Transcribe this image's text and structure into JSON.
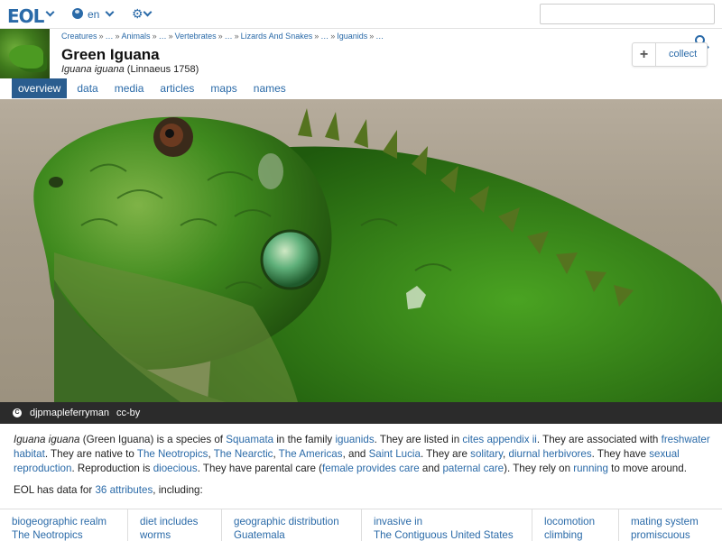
{
  "header": {
    "logo": "EOL",
    "language": "en",
    "search_placeholder": ""
  },
  "breadcrumb": [
    "Creatures",
    "…",
    "Animals",
    "…",
    "Vertebrates",
    "…",
    "Lizards And Snakes",
    "…",
    "Iguanids",
    "…"
  ],
  "page": {
    "title": "Green Iguana",
    "scientific_name": "Iguana iguana",
    "authority": "(Linnaeus 1758)",
    "collect_label": "collect"
  },
  "tabs": [
    {
      "label": "overview",
      "active": true
    },
    {
      "label": "data",
      "active": false
    },
    {
      "label": "media",
      "active": false
    },
    {
      "label": "articles",
      "active": false
    },
    {
      "label": "maps",
      "active": false
    },
    {
      "label": "names",
      "active": false
    }
  ],
  "image": {
    "author": "djpmapleferryman",
    "license": "cc-by"
  },
  "summary": {
    "s1": "Iguana iguana",
    "s2": " (Green Iguana) is a species of ",
    "l1": "Squamata",
    "s3": " in the family ",
    "l2": "iguanids",
    "s4": ". They are listed in ",
    "l3": "cites appendix ii",
    "s5": ". They are associated with ",
    "l4": "freshwater habitat",
    "s6": ". They are native to ",
    "l5": "The Neotropics",
    "s7": ", ",
    "l6": "The Nearctic",
    "s8": ", ",
    "l7": "The Americas",
    "s9": ", and ",
    "l8": "Saint Lucia",
    "s10": ". They are ",
    "l9": "solitary",
    "s11": ", ",
    "l10": "diurnal herbivores",
    "s12": ". They have ",
    "l11": "sexual reproduction",
    "s13": ". Reproduction is ",
    "l12": "dioecious",
    "s14": ". They have parental care (",
    "l13": "female provides care",
    "s15": " and ",
    "l14": "paternal care",
    "s16": "). They rely on ",
    "l15": "running",
    "s17": " to move around."
  },
  "eol_data": {
    "prefix": "EOL has data for ",
    "link": "36 attributes",
    "suffix": ", including:"
  },
  "attributes": [
    {
      "key": "biogeographic realm",
      "value": "The Neotropics"
    },
    {
      "key": "diet includes",
      "value": "worms"
    },
    {
      "key": "geographic distribution",
      "value": "Guatemala"
    },
    {
      "key": "invasive in",
      "value": "The Contiguous United States"
    },
    {
      "key": "locomotion",
      "value": "climbing"
    },
    {
      "key": "mating system",
      "value": "promiscuous"
    }
  ],
  "colors": {
    "link": "#2a6aa8",
    "active_tab": "#2a5d8f",
    "caption_bar": "#2b2b2b"
  }
}
